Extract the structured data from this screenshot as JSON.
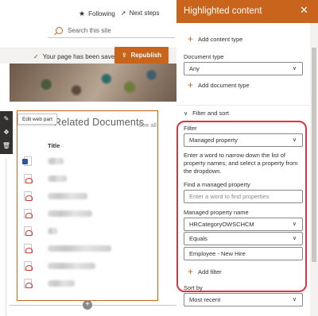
{
  "header": {
    "following_label": "Following",
    "next_steps_label": "Next steps",
    "search_placeholder": "Search this site"
  },
  "savebar": {
    "status_text": "Your page has been saved",
    "republish_label": "Republish"
  },
  "webpart": {
    "tooltip": "Edit web part",
    "title": "Related Documents",
    "see_all": "See all",
    "column_title": "Title",
    "rows": [
      {
        "icon": "word-doc-icon",
        "width": 0
      },
      {
        "icon": "pdf-icon"
      },
      {
        "icon": "pdf-icon"
      },
      {
        "icon": "pdf-icon"
      },
      {
        "icon": "pdf-icon"
      },
      {
        "icon": "pdf-icon"
      },
      {
        "icon": "pdf-icon"
      },
      {
        "icon": "pdf-icon"
      }
    ]
  },
  "pane": {
    "title": "Highlighted content",
    "add_content_type": "Add content type",
    "document_type_label": "Document type",
    "document_type_value": "Any",
    "add_document_type": "Add document type",
    "filter_sort_heading": "Filter and sort",
    "filter_label": "Filter",
    "filter_value": "Managed property",
    "help_text": "Enter a word to narrow down the list of property names, and select a property from the dropdown.",
    "find_label": "Find a managed property",
    "find_placeholder": "Enter a word to find properties",
    "managed_name_label": "Managed property name",
    "managed_name_value": "HRCategoryOWSCHCM",
    "operator_value": "Equals",
    "filter_text_value": "Employee - New Hire",
    "add_filter": "Add filter",
    "sort_by_label": "Sort by",
    "sort_by_value": "Most recent"
  },
  "colors": {
    "accent": "#c8641c",
    "highlight_outline": "#e0323c"
  }
}
